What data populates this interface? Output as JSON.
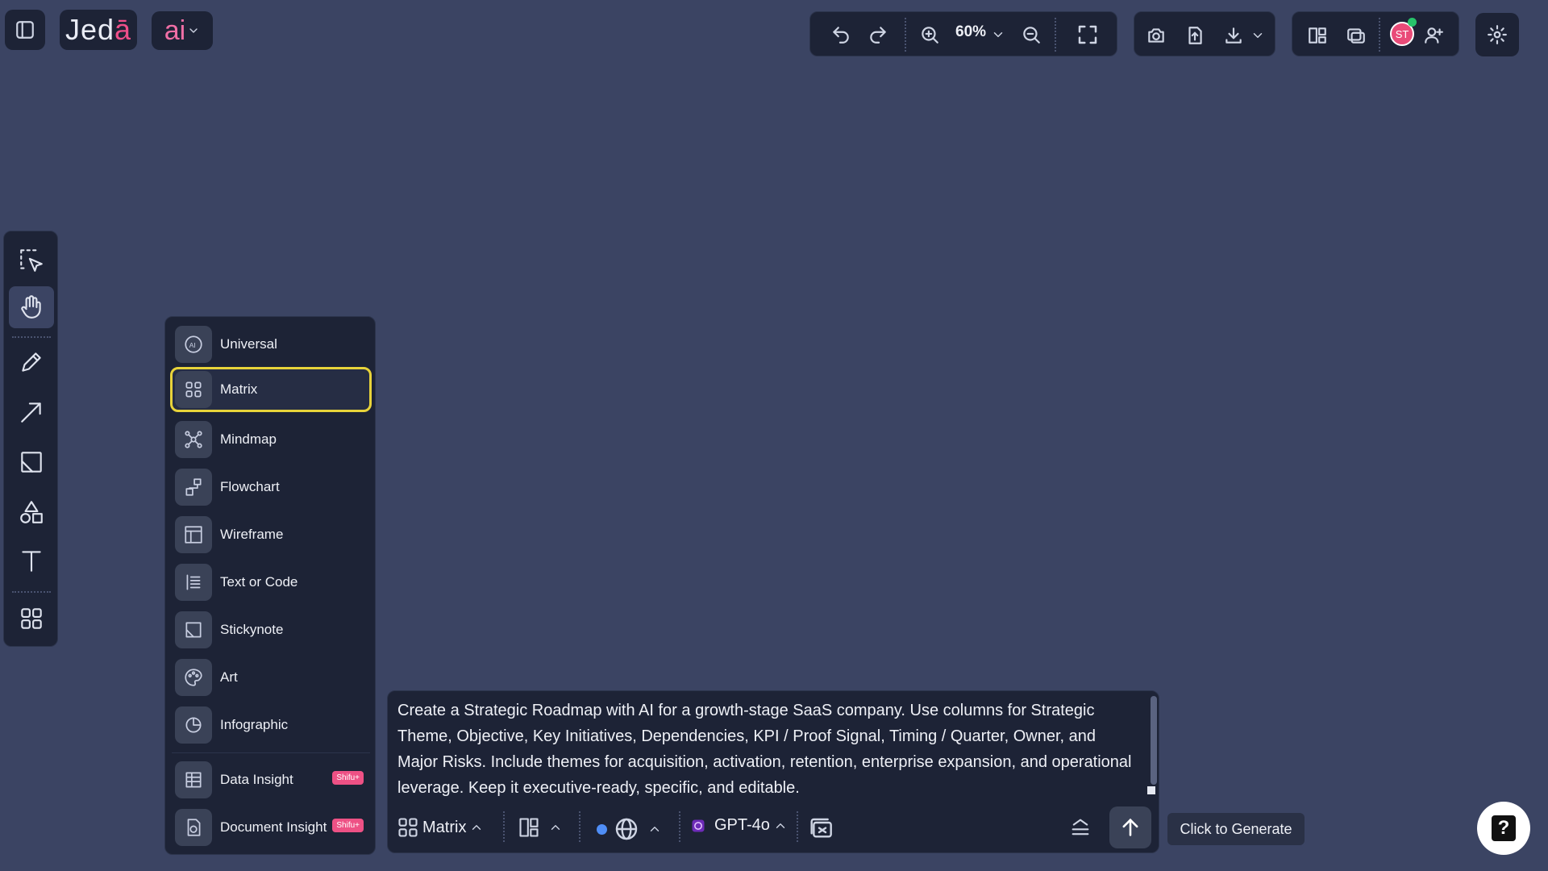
{
  "app": {
    "logo_main": "Jed",
    "logo_accent": "ā",
    "ai_label": "ai"
  },
  "toolbar": {
    "zoom_level": "60%",
    "avatar_initials": "ST"
  },
  "mode_menu": {
    "items": [
      {
        "label": "Universal",
        "icon": "ai-circle-icon"
      },
      {
        "label": "Matrix",
        "icon": "grid-icon",
        "selected": true
      },
      {
        "label": "Mindmap",
        "icon": "mindmap-icon"
      },
      {
        "label": "Flowchart",
        "icon": "flowchart-icon"
      },
      {
        "label": "Wireframe",
        "icon": "wireframe-icon"
      },
      {
        "label": "Text or Code",
        "icon": "text-code-icon"
      },
      {
        "label": "Stickynote",
        "icon": "stickynote-icon"
      },
      {
        "label": "Art",
        "icon": "art-icon"
      },
      {
        "label": "Infographic",
        "icon": "infographic-icon"
      },
      {
        "label": "Data Insight",
        "icon": "data-insight-icon",
        "badge": "Shifu+"
      },
      {
        "label": "Document Insight",
        "icon": "document-insight-icon",
        "badge": "Shifu+"
      }
    ]
  },
  "prompt": {
    "text": "Create a Strategic Roadmap with AI for a growth-stage SaaS company. Use columns for Strategic Theme, Objective, Key Initiatives, Dependencies, KPI / Proof Signal, Timing / Quarter, Owner, and Major Risks. Include themes for acquisition, activation, retention, enterprise expansion, and operational leverage. Keep it executive-ready, specific, and editable.",
    "mode_label": "Matrix",
    "model_label": "GPT-4o",
    "generate_tooltip": "Click to Generate"
  },
  "colors": {
    "canvas": "#3b4463",
    "panel": "#1d2336",
    "accent_pink": "#ef4f8a",
    "selected_outline": "#e8d33a",
    "badge": "#ee5185",
    "online": "#27c36a"
  }
}
